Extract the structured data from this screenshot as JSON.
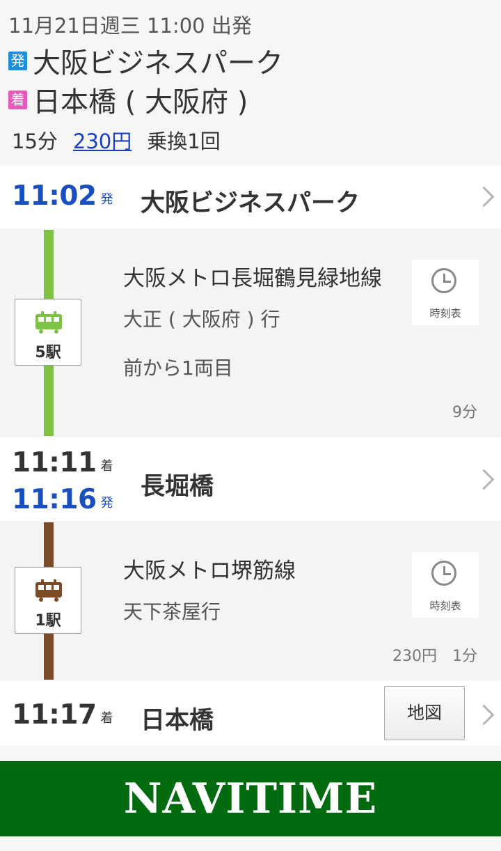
{
  "header": {
    "datetime": "11月21日週三 11:00 出発",
    "departure_tag": "発",
    "departure_station": "大阪ビジネスパーク",
    "arrival_tag": "着",
    "arrival_station": "日本橋 ( 大阪府 )",
    "duration": "15分",
    "fare": "230円",
    "transfers": "乗換1回"
  },
  "stations": [
    {
      "time1": "11:02",
      "suffix1": "発",
      "name": "大阪ビジネスパーク"
    },
    {
      "time1": "11:11",
      "suffix1": "着",
      "time2": "11:16",
      "suffix2": "発",
      "name": "長堀橋"
    },
    {
      "time1": "11:17",
      "suffix1": "着",
      "name": "日本橋",
      "map_label": "地図"
    }
  ],
  "segments": [
    {
      "line_name": "大阪メトロ長堀鶴見緑地線",
      "destination": "大正 ( 大阪府 ) 行",
      "car_info": "前から1両目",
      "stops": "5駅",
      "duration": "9分",
      "timetable_label": "時刻表",
      "color": "#7dc242"
    },
    {
      "line_name": "大阪メトロ堺筋線",
      "destination": "天下茶屋行",
      "stops": "1駅",
      "fare_and_duration": "230円　1分",
      "timetable_label": "時刻表",
      "color": "#7b4a26"
    }
  ],
  "banner": {
    "text": "NAVITIME",
    "color": "#006b0e"
  },
  "icons": [
    "train-icon",
    "clock-icon",
    "chevron-right-icon"
  ]
}
